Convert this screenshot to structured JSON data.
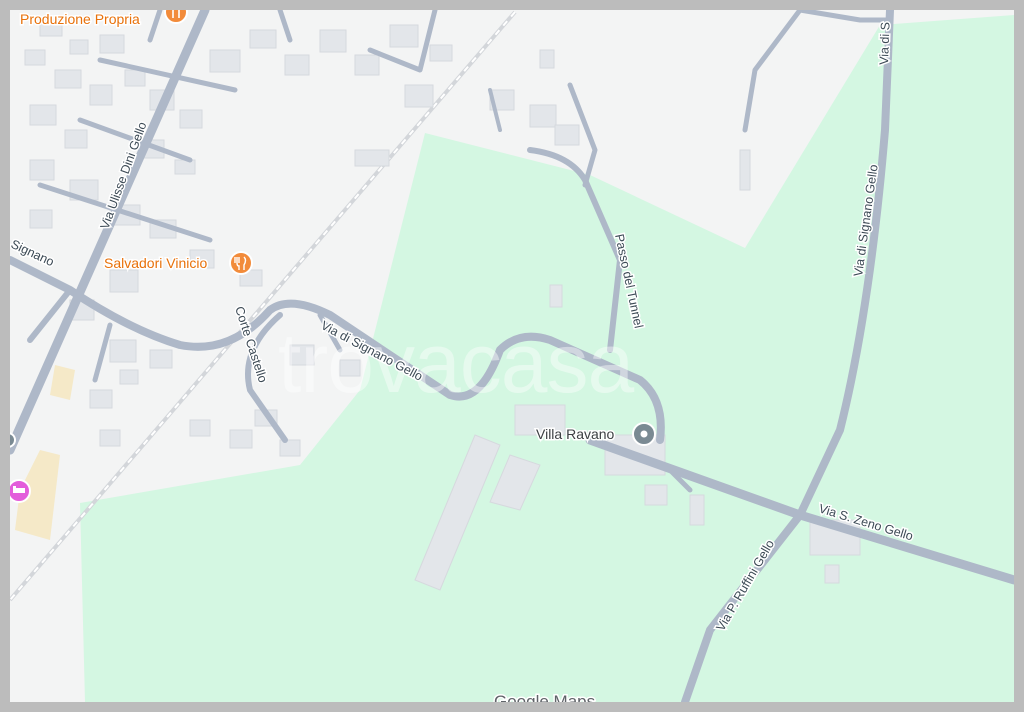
{
  "map": {
    "pois": [
      {
        "name": "Produzione Propria",
        "icon": "restaurant-icon"
      },
      {
        "name": "Salvadori Vinicio",
        "icon": "restaurant-icon"
      },
      {
        "name": "Villa Ravano",
        "icon": "place-pin-icon"
      }
    ],
    "roads": {
      "ulisse_dini": "Via Ulisse Dini Gello",
      "signano_left": "Signano",
      "signano_main": "Via di Signano Gello",
      "signano_east": "Via di Signano Gello",
      "signano_east_top": "Via di S",
      "corte_castello": "Corte Castello",
      "passo_tunnel": "Passo del Tunnel",
      "zeno": "Via S. Zeno Gello",
      "ruffini": "Via P. Ruffini Gello"
    },
    "watermark": "trovacasa",
    "attribution": "Google Maps",
    "colors": {
      "land": "#f3f4f4",
      "park": "#d4f7e2",
      "road": "#aeb8c8",
      "building": "#e3e5e8",
      "restaurant": "#f28b3a",
      "hotel": "#e35ddb",
      "pin": "#7a8a93"
    }
  }
}
